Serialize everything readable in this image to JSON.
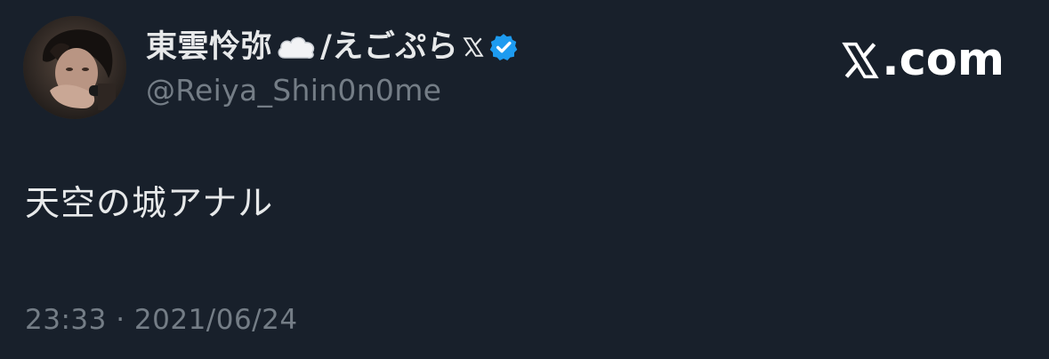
{
  "header": {
    "display_name_part1": "東雲怜弥",
    "display_name_part2": "/えごぷら",
    "handle": "@Reiya_Shin0n0me",
    "icons": [
      "cloud-emoji-icon",
      "x-logo-icon",
      "verified-badge-icon"
    ]
  },
  "brand": {
    "suffix": ".com",
    "icon": "x-logo-icon"
  },
  "tweet": {
    "text": "天空の城アナル",
    "timestamp": "23:33 · 2021/06/24"
  },
  "colors": {
    "background": "#18202b",
    "primary_text": "#e7e9ea",
    "secondary_text": "#747d86",
    "verified_blue": "#1d9bf0"
  }
}
